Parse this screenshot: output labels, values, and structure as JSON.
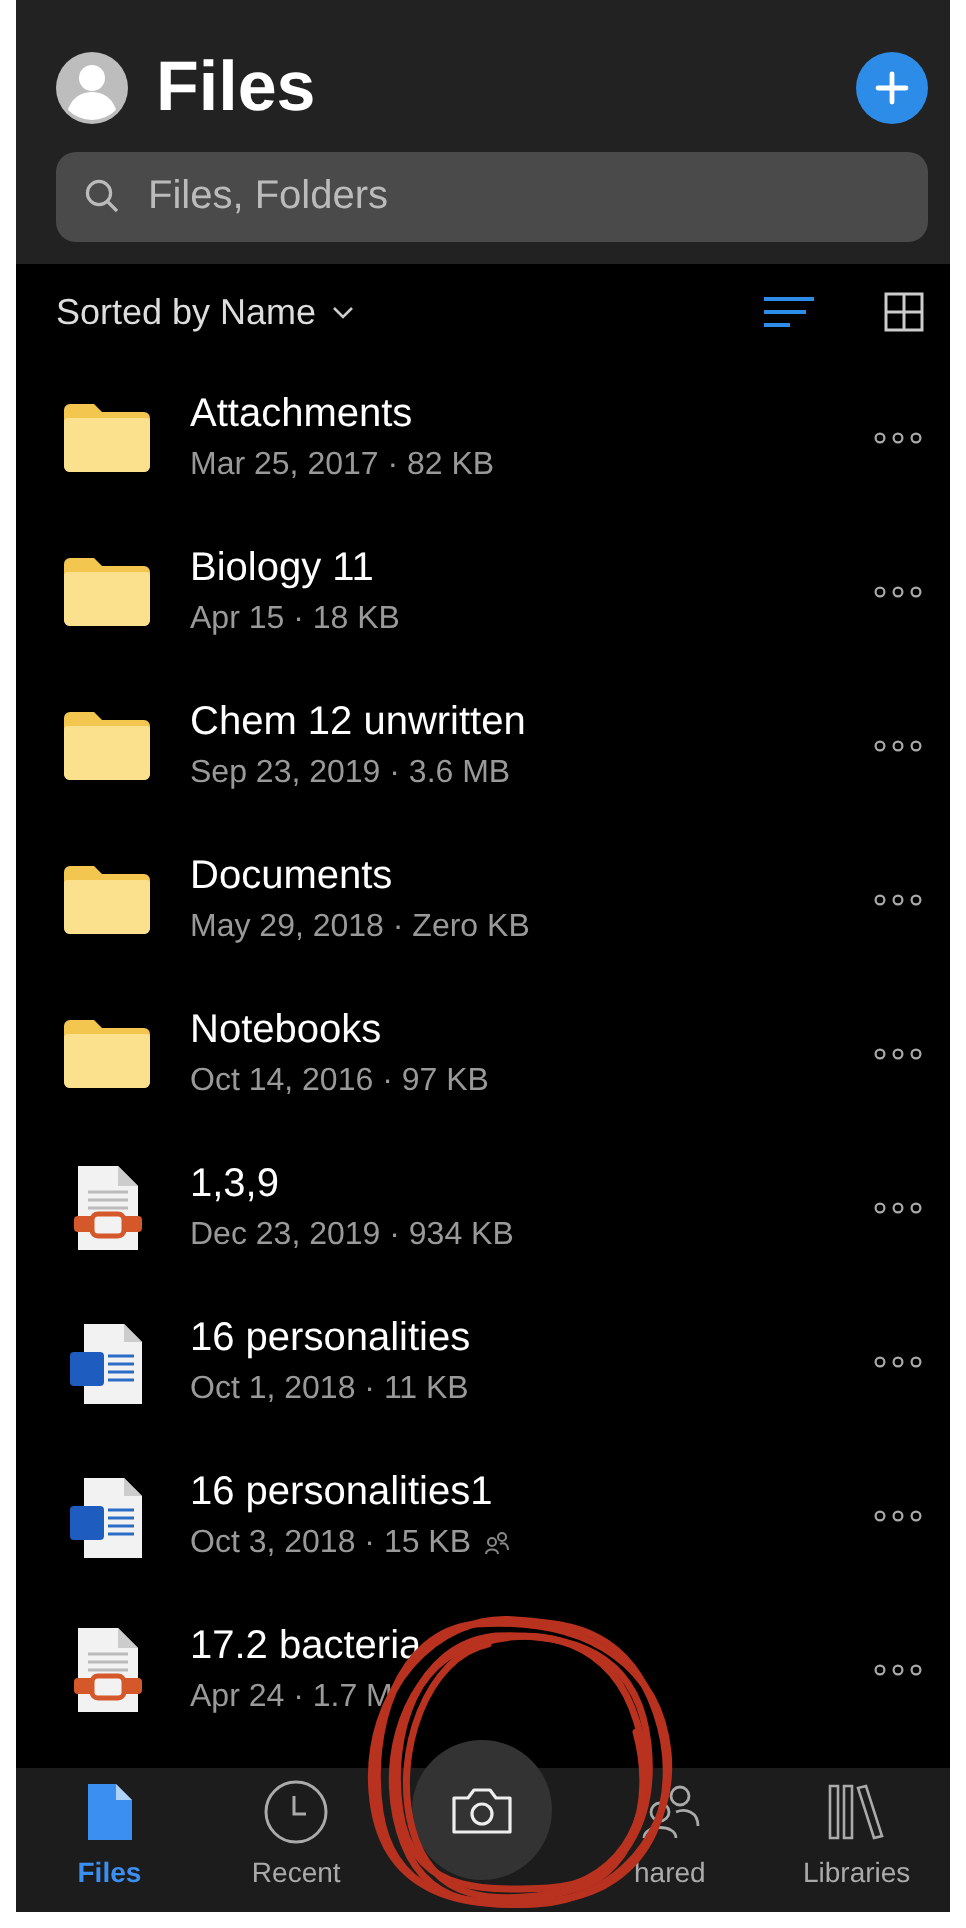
{
  "header": {
    "title": "Files",
    "search": {
      "placeholder": "Files, Folders"
    }
  },
  "sort": {
    "label": "Sorted by Name",
    "views": [
      {
        "kind": "list",
        "selected": true
      },
      {
        "kind": "grid",
        "selected": false
      }
    ]
  },
  "files": [
    {
      "kind": "folder",
      "name": "Attachments",
      "details": "Mar 25, 2017 · 82 KB",
      "shared": false
    },
    {
      "kind": "folder",
      "name": "Biology 11",
      "details": "Apr 15 · 18 KB",
      "shared": false
    },
    {
      "kind": "folder",
      "name": "Chem 12 unwritten",
      "details": "Sep 23, 2019 · 3.6 MB",
      "shared": false
    },
    {
      "kind": "folder",
      "name": "Documents",
      "details": "May 29, 2018 · Zero KB",
      "shared": false
    },
    {
      "kind": "folder",
      "name": "Notebooks",
      "details": "Oct 14, 2016 · 97 KB",
      "shared": false
    },
    {
      "kind": "pdf",
      "name": "1,3,9",
      "details": "Dec 23, 2019 · 934 KB",
      "shared": false
    },
    {
      "kind": "word",
      "name": "16 personalities",
      "details": "Oct 1, 2018 · 11 KB",
      "shared": false
    },
    {
      "kind": "word",
      "name": "16 personalities1",
      "details": "Oct 3, 2018 · 15 KB",
      "shared": true
    },
    {
      "kind": "pdf",
      "name": "17.2 bacteria",
      "details": "Apr 24 · 1.7 M",
      "shared": false
    }
  ],
  "tabs": [
    {
      "kind": "files",
      "label": "Files",
      "selected": true
    },
    {
      "kind": "recent",
      "label": "Recent",
      "selected": false
    },
    {
      "kind": "camera",
      "selected": false
    },
    {
      "kind": "shared",
      "label": "hared",
      "selected": false
    },
    {
      "kind": "libraries",
      "label": "Libraries",
      "selected": false
    }
  ]
}
